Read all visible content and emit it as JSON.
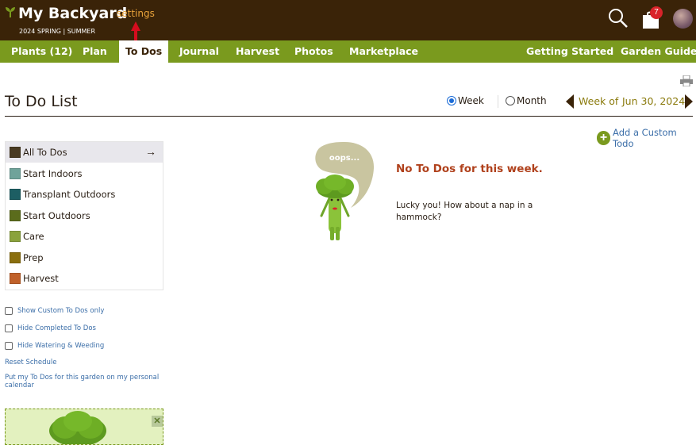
{
  "header": {
    "title": "My Backyard",
    "settings_label": "settings",
    "season": "2024 SPRING | SUMMER",
    "notification_count": "7"
  },
  "nav": {
    "items": [
      {
        "label": "Plants (12)"
      },
      {
        "label": "Plan"
      },
      {
        "label": "To Dos"
      },
      {
        "label": "Journal"
      },
      {
        "label": "Harvest"
      },
      {
        "label": "Photos"
      },
      {
        "label": "Marketplace"
      }
    ],
    "right_items": [
      {
        "label": "Getting Started"
      },
      {
        "label": "Garden Guide"
      }
    ],
    "active": "To Dos"
  },
  "main": {
    "page_title": "To Do List",
    "view": {
      "week_label": "Week",
      "month_label": "Month",
      "selected": "Week"
    },
    "week_prefix": "Week of",
    "week_date": "Jun 30, 2024",
    "add_custom_label": "Add a Custom Todo",
    "empty_title": "No To Dos for this week.",
    "empty_message": "Lucky you! How about a nap in a hammock?",
    "mascot_bubble_text": "oops..."
  },
  "sidebar": {
    "categories": [
      {
        "label": "All To Dos",
        "color": "#4a3b22",
        "active": true
      },
      {
        "label": "Start Indoors",
        "color": "#6fa39a"
      },
      {
        "label": "Transplant Outdoors",
        "color": "#1d5e63"
      },
      {
        "label": "Start Outdoors",
        "color": "#5b6c1c"
      },
      {
        "label": "Care",
        "color": "#8aa23c"
      },
      {
        "label": "Prep",
        "color": "#8a6e0e"
      },
      {
        "label": "Harvest",
        "color": "#c0612a"
      }
    ],
    "options": [
      {
        "label": "Show Custom To Dos only",
        "checked": false
      },
      {
        "label": "Hide Completed To Dos",
        "checked": false
      },
      {
        "label": "Hide Watering & Weeding",
        "checked": false
      }
    ],
    "reset_label": "Reset Schedule",
    "calendar_label": "Put my To Dos for this garden on my personal calendar"
  },
  "colors": {
    "header_bg": "#3a2308",
    "nav_bg": "#7a9a1e",
    "accent": "#e8a23a",
    "empty_title": "#b0411c"
  },
  "icons": [
    "sprout-icon",
    "search-icon",
    "shopping-bag-icon",
    "printer-icon",
    "plus-circle-icon",
    "arrow-right-icon",
    "close-icon"
  ]
}
